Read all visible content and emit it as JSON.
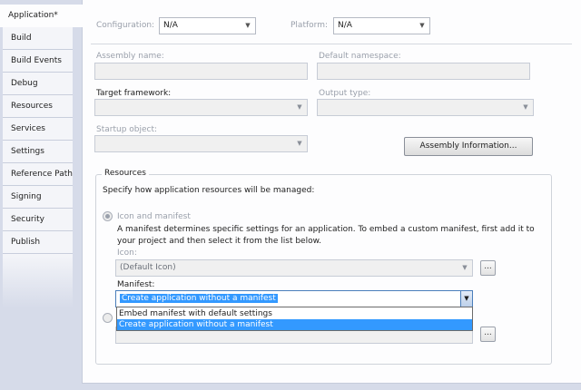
{
  "tabs": [
    {
      "label": "Application*",
      "active": true
    },
    {
      "label": "Build"
    },
    {
      "label": "Build Events"
    },
    {
      "label": "Debug"
    },
    {
      "label": "Resources"
    },
    {
      "label": "Services"
    },
    {
      "label": "Settings"
    },
    {
      "label": "Reference Paths"
    },
    {
      "label": "Signing"
    },
    {
      "label": "Security"
    },
    {
      "label": "Publish"
    }
  ],
  "top": {
    "configuration_label": "Configuration:",
    "configuration_value": "N/A",
    "platform_label": "Platform:",
    "platform_value": "N/A"
  },
  "fields": {
    "assembly_name_label": "Assembly name:",
    "default_namespace_label": "Default namespace:",
    "target_framework_label": "Target framework:",
    "output_type_label": "Output type:",
    "startup_object_label": "Startup object:",
    "assembly_info_button": "Assembly Information..."
  },
  "resources": {
    "group_title": "Resources",
    "description": "Specify how application resources will be managed:",
    "icon_manifest_option": "Icon and manifest",
    "icon_manifest_desc_line1": "A manifest determines specific settings for an application. To embed a custom manifest, first add it to",
    "icon_manifest_desc_line2": "your project and then select it from the list below.",
    "icon_label": "Icon:",
    "icon_value": "(Default Icon)",
    "browse_label": "...",
    "manifest_label": "Manifest:",
    "manifest_value": "Create application without a manifest",
    "manifest_options": [
      "Embed manifest with default settings",
      "Create application without a manifest"
    ]
  },
  "colors": {
    "selection": "#3399ff",
    "chrome": "#d6dbe9"
  }
}
